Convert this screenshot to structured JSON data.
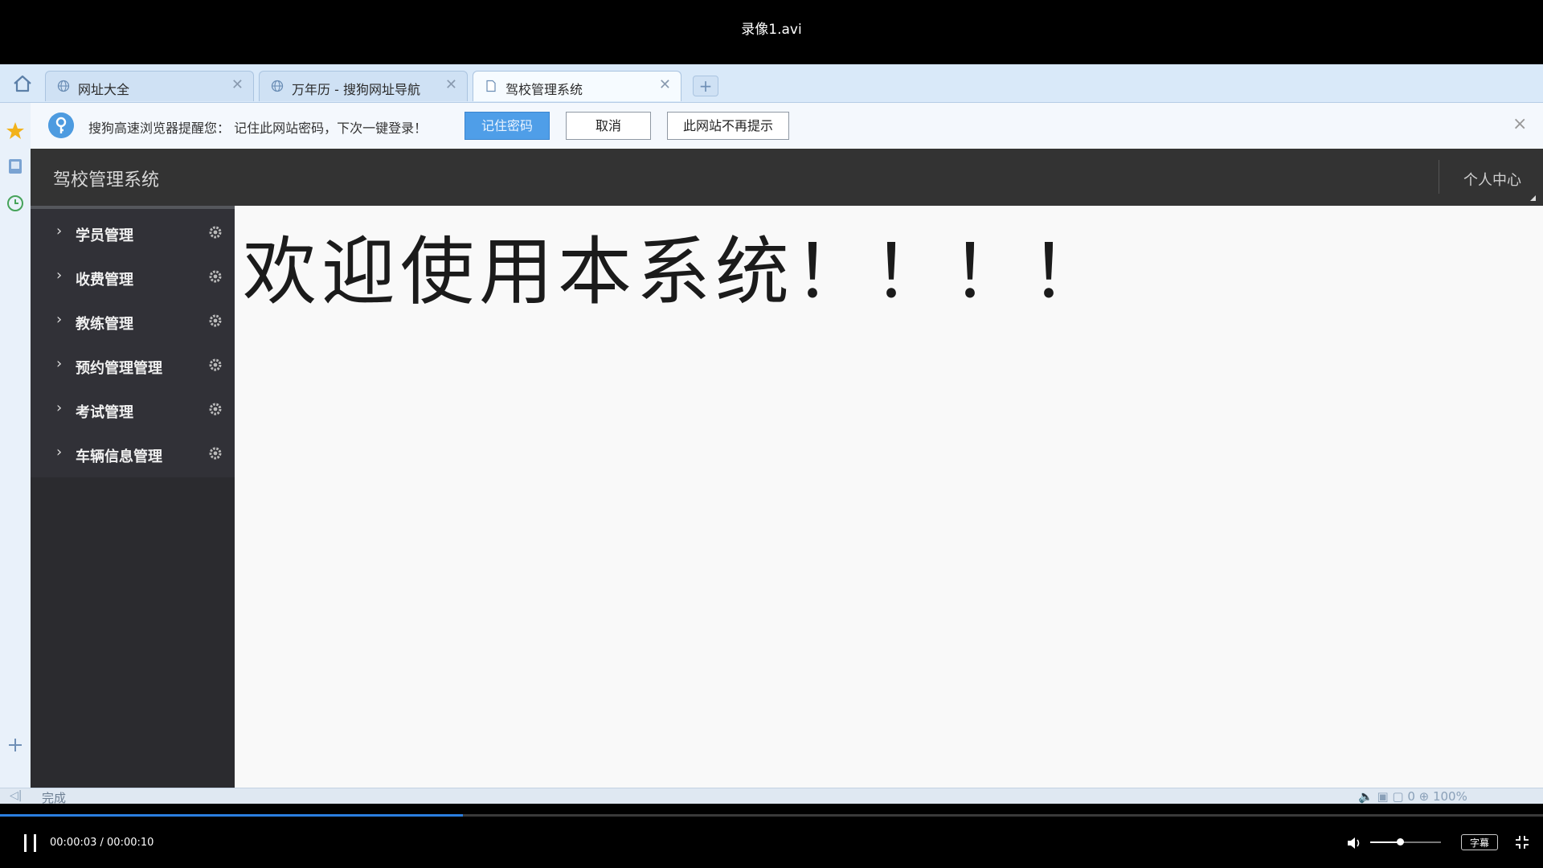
{
  "player": {
    "title": "录像1.avi",
    "time_current": "00:00:03",
    "time_total": "00:00:10",
    "time_display": "00:00:03 / 00:00:10",
    "progress_fraction": 0.3,
    "volume_fraction": 0.42,
    "subtitle_label": "字幕",
    "accent_color": "#2b7fe0"
  },
  "browser": {
    "tabs": [
      {
        "label": "网址大全",
        "icon": "globe-icon",
        "active": false
      },
      {
        "label": "万年历 - 搜狗网址导航",
        "icon": "globe-icon",
        "active": false
      },
      {
        "label": "驾校管理系统",
        "icon": "page-icon",
        "active": true
      }
    ],
    "new_tab_label": "+",
    "rail_icons": [
      "star-icon",
      "book-icon",
      "clock-icon",
      "plus-icon"
    ],
    "password_bar": {
      "message": "搜狗高速浏览器提醒您： 记住此网站密码，下次一键登录！",
      "remember_label": "记住密码",
      "cancel_label": "取消",
      "never_label": "此网站不再提示",
      "close_label": "×"
    },
    "status": {
      "text": "完成",
      "right": "🔈  ▣  ▢ 0  ⊕ 100%"
    }
  },
  "app": {
    "brand": "驾校管理系统",
    "personal_center": "个人中心",
    "menu": [
      {
        "label": "学员管理"
      },
      {
        "label": "收费管理"
      },
      {
        "label": "教练管理"
      },
      {
        "label": "预约管理管理"
      },
      {
        "label": "考试管理"
      },
      {
        "label": "车辆信息管理"
      }
    ],
    "welcome": "欢迎使用本系统！！！！",
    "header_color": "#333333",
    "sidebar_color": "#2b2b2f"
  }
}
